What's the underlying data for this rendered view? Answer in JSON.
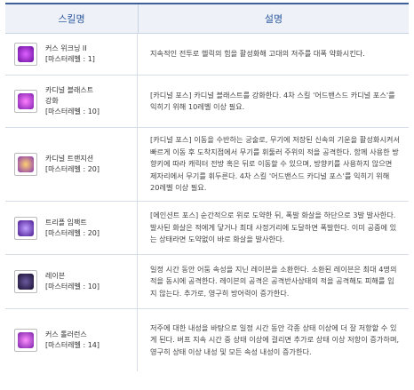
{
  "header": {
    "col_skill": "스킬명",
    "col_desc": "설명"
  },
  "skills": [
    {
      "name": "커스 위크닝 II",
      "name2": "",
      "level": "[마스터레벨 : 1]",
      "desc": "지속적인 전투로 헬릭의 힘을 활성화해 고대의 저주를 대폭 약화시킨다.",
      "icon": "curse-weakening-icon",
      "color": "#8a2be2"
    },
    {
      "name": "카디널 블래스트",
      "name2": "강화",
      "level": "[마스터레벨 : 10]",
      "desc": "[카디널 포스] 카디널 블래스트를 강화한다. 4차 스킬 '어드밴스드 카디널 포스'를 익히기 위해 10레벨 이상 필요.",
      "icon": "cardinal-blast-icon",
      "color": "#b03ad8"
    },
    {
      "name": "카디널 트랜지션",
      "name2": "",
      "level": "[마스터레벨 : 20]",
      "desc": "[카디널 포스] 이동을 수반하는 궁술로, 무기에 저장된 신속의 기운을 활성화시켜서 빠르게 이동 후 도착지점에서 무기를 휘둘러 주위의 적을 공격한다. 함께 사용한 방향키에 따라 캐릭터 전방 혹은 뒤로 이동할 수 있으며, 방향키를 사용하지 않으면 제자리에서 무기를 휘두른다. 4차 스킬 '어드밴스드 카디널 포스'를 익히기 위해 20레벨 이상 필요.",
      "icon": "cardinal-transition-icon",
      "color": "#9a4fb8"
    },
    {
      "name": "트리플 임팩트",
      "name2": "",
      "level": "[마스터레벨 : 20]",
      "desc": "[에인션트 포스] 순간적으로 위로 도약한 뒤, 폭발 화살을 하단으로 3발 발사한다. 발사된 화살은 적에게 닿거나 최대 사정거리에 도달하면 폭발한다. 이미 공중에 있는 상태라면 도약없이 바로 화살을 발사한다.",
      "icon": "triple-impact-icon",
      "color": "#6a2fc0"
    },
    {
      "name": "레이븐",
      "name2": "",
      "level": "[마스터레벨 : 10]",
      "desc": "일정 시간 동안 어둠 속성을 지닌 레이븐을 소환한다. 소환된 레이븐은 최대 4명의 적을 동시에 공격한다. 레이븐의 공격은 공격반사상태의 적을 공격해도 피해를 입지 않는다. 추가로, 영구히 방어력이 증가한다.",
      "icon": "raven-icon",
      "color": "#3a2a6a"
    },
    {
      "name": "커스 톨러런스",
      "name2": "",
      "level": "[마스터레벨 : 14]",
      "desc": "저주에 대한 내성을 바탕으로 일정 시간 동안 각종 상태 이상에 더 잘 저항할 수 있게 된다. 버프 지속 시간 중 상태 이상에 걸리면 추가로 상태 이상 저항이 증가하며, 영구히 상태 이상 내성 및 모든 속성 내성이 증가한다.",
      "icon": "curse-tolerance-icon",
      "color": "#a040c8"
    }
  ]
}
